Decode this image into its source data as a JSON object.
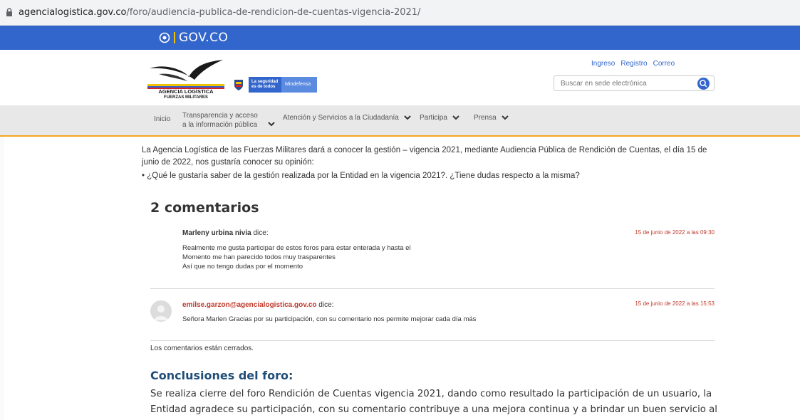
{
  "browser": {
    "url_host": "agencialogistica.gov.co",
    "url_path": "/foro/audiencia-publica-de-rendicion-de-cuentas-vigencia-2021/"
  },
  "govbar": {
    "label": "GOV.CO"
  },
  "header": {
    "agency_line1": "AGENCIA LOGÍSTICA",
    "agency_line2": "FUERZAS MILITARES",
    "mindefensa_line1": "La seguridad",
    "mindefensa_line2": "es de todos",
    "mindefensa_name": "Mindefensa",
    "links": [
      "Ingreso",
      "Registro",
      "Correo"
    ],
    "search_placeholder": "Buscar en sede electrónica"
  },
  "nav": {
    "items": [
      {
        "label": "Inicio"
      },
      {
        "label": "Transparencia y acceso",
        "label2": "a la información pública"
      },
      {
        "label": "Atención y Servicios a la Ciudadanía"
      },
      {
        "label": "Participa"
      },
      {
        "label": "Prensa"
      }
    ]
  },
  "main": {
    "intro": "La Agencia Logística de las Fuerzas Militares dará a conocer la gestión – vigencia 2021, mediante Audiencia Pública de Rendición de Cuentas, el día 15 de junio de 2022, nos gustaría conocer su opinión:",
    "question": "• ¿Qué le gustaría saber de la gestión realizada por la Entidad en la vigencia 2021?. ¿Tiene dudas respecto a la misma?",
    "comments_title": "2 comentarios",
    "comments": [
      {
        "author": "Marleny urbina nivia",
        "says": "dice:",
        "date": "15 de junio de 2022 a las 09:30",
        "lines": [
          "Realmente me gusta participar de estos foros para estar enterada y hasta el",
          "Momento me han parecido todos muy trasparentes",
          "Así que no tengo dudas por el momento"
        ]
      },
      {
        "author": "emilse.garzon@agencialogistica.gov.co",
        "says": "dice:",
        "date": "15 de junio de 2022 a las 15:53",
        "lines": [
          "Señora Marlen Gracias por su participación, con su comentario nos permite mejorar cada día más"
        ]
      }
    ],
    "closed": "Los comentarios están cerrados.",
    "conclusions_title": "Conclusiones del foro:",
    "conclusions_text": "Se realiza cierre del foro Rendición de Cuentas vigencia 2021, dando como resultado la participación de un usuario, la Entidad agradece su participación, con su comentario contribuye a una mejora continua y a brindar un buen servicio al ciudadano."
  },
  "colors": {
    "gov_blue": "#3366cc",
    "nav_border": "#f5a623",
    "date_red": "#c0392b",
    "email_red": "#c0392b",
    "conclusions_blue": "#1f4e79"
  }
}
